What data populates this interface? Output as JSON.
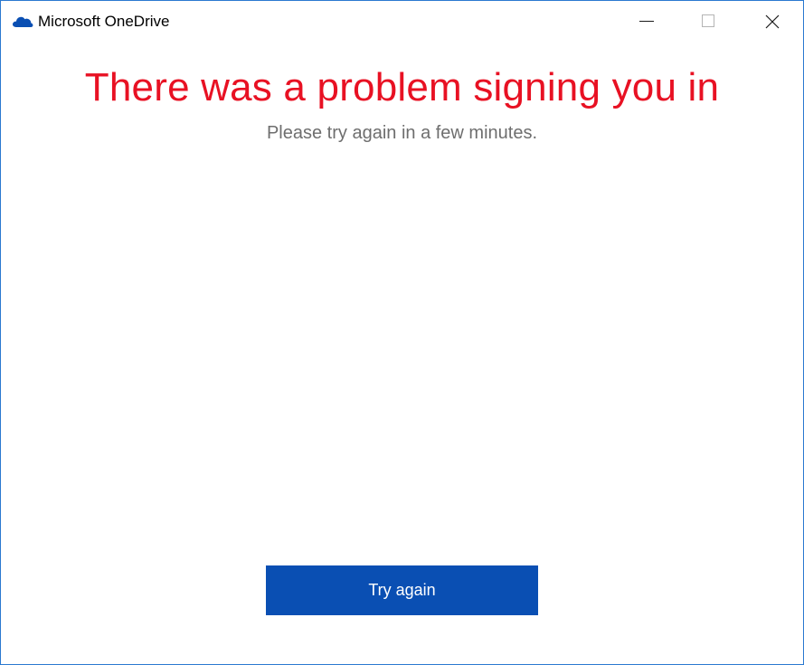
{
  "window": {
    "title": "Microsoft OneDrive",
    "app_icon": "onedrive-cloud-icon",
    "controls": [
      "minimize-icon",
      "maximize-icon",
      "close-icon"
    ]
  },
  "main": {
    "headline": "There was a problem signing you in",
    "subtext": "Please try again in a few minutes.",
    "primary_button_label": "Try again"
  },
  "colors": {
    "headline": "#e81123",
    "subtext": "#6e6e6e",
    "button_background": "#0a4fb3",
    "button_text": "#ffffff",
    "window_border": "#2b79d0",
    "app_icon": "#0a4fb3"
  }
}
